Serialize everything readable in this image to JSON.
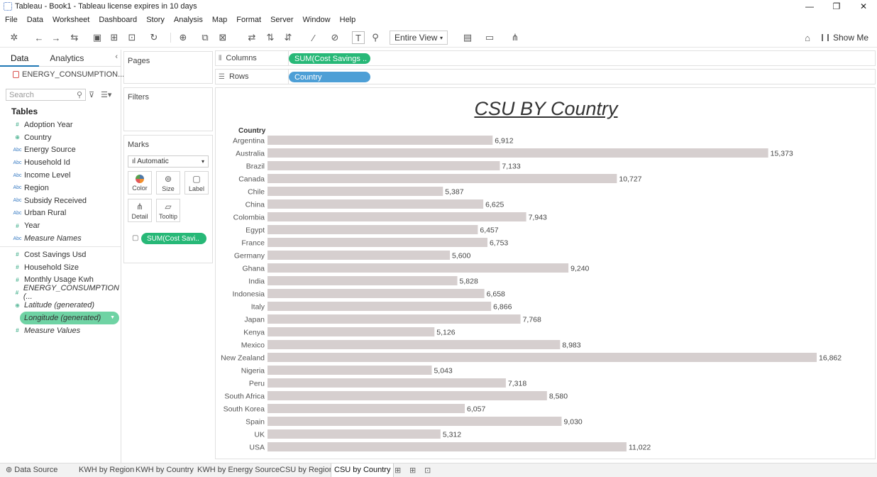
{
  "window": {
    "title": "Tableau - Book1 - Tableau license expires in 10 days",
    "controls": [
      "—",
      "❐",
      "✕"
    ]
  },
  "menu": [
    "File",
    "Data",
    "Worksheet",
    "Dashboard",
    "Story",
    "Analysis",
    "Map",
    "Format",
    "Server",
    "Window",
    "Help"
  ],
  "toolbar": {
    "view_select": "Entire View",
    "show_me": "Show Me"
  },
  "data_pane": {
    "tabs": [
      "Data",
      "Analytics"
    ],
    "datasource": "ENERGY_CONSUMPTION...",
    "search_placeholder": "Search",
    "tables_label": "Tables",
    "dimensions": [
      {
        "name": "Adoption Year",
        "type": "#"
      },
      {
        "name": "Country",
        "type": "⊕"
      },
      {
        "name": "Energy Source",
        "type": "Abc"
      },
      {
        "name": "Household Id",
        "type": "Abc"
      },
      {
        "name": "Income Level",
        "type": "Abc"
      },
      {
        "name": "Region",
        "type": "Abc"
      },
      {
        "name": "Subsidy Received",
        "type": "Abc"
      },
      {
        "name": "Urban Rural",
        "type": "Abc"
      },
      {
        "name": "Year",
        "type": "#"
      },
      {
        "name": "Measure Names",
        "type": "Abc"
      }
    ],
    "measures": [
      {
        "name": "Cost Savings Usd",
        "type": "#"
      },
      {
        "name": "Household Size",
        "type": "#"
      },
      {
        "name": "Monthly Usage Kwh",
        "type": "#"
      },
      {
        "name": "ENERGY_CONSUMPTION (...",
        "type": "#"
      },
      {
        "name": "Latitude (generated)",
        "type": "⊕"
      },
      {
        "name": "Longitude (generated)",
        "type": "⊕"
      },
      {
        "name": "Measure Values",
        "type": "#"
      }
    ]
  },
  "cards": {
    "pages": "Pages",
    "filters": "Filters",
    "marks": "Marks",
    "mark_type": "Automatic",
    "mark_buttons": [
      "Color",
      "Size",
      "Label",
      "Detail",
      "Tooltip"
    ],
    "mark_pill": "SUM(Cost Savi.."
  },
  "shelves": {
    "columns_label": "Columns",
    "columns_pill": "SUM(Cost Savings ..",
    "rows_label": "Rows",
    "rows_pill": "Country"
  },
  "chart_data": {
    "type": "bar",
    "orientation": "horizontal",
    "title": "CSU BY Country",
    "row_header": "Country",
    "categories": [
      "Argentina",
      "Australia",
      "Brazil",
      "Canada",
      "Chile",
      "China",
      "Colombia",
      "Egypt",
      "France",
      "Germany",
      "Ghana",
      "India",
      "Indonesia",
      "Italy",
      "Japan",
      "Kenya",
      "Mexico",
      "New Zealand",
      "Nigeria",
      "Peru",
      "South Africa",
      "South Korea",
      "Spain",
      "UK",
      "USA"
    ],
    "values": [
      6912,
      15373,
      7133,
      10727,
      5387,
      6625,
      7943,
      6457,
      6753,
      5600,
      9240,
      5828,
      6658,
      6866,
      7768,
      5126,
      8983,
      16862,
      5043,
      7318,
      8580,
      6057,
      9030,
      5312,
      11022
    ],
    "value_labels": [
      "6,912",
      "15,373",
      "7,133",
      "10,727",
      "5,387",
      "6,625",
      "7,943",
      "6,457",
      "6,753",
      "5,600",
      "9,240",
      "5,828",
      "6,658",
      "6,866",
      "7,768",
      "5,126",
      "8,983",
      "16,862",
      "5,043",
      "7,318",
      "8,580",
      "6,057",
      "9,030",
      "5,312",
      "11,022"
    ],
    "bar_color": "#d6cfcf",
    "xlim": [
      0,
      16862
    ]
  },
  "sheets": {
    "data_source": "Data Source",
    "tabs": [
      "KWH by Region",
      "KWH by Country",
      "KWH by Energy Source",
      "CSU by Region",
      "CSU by Country"
    ],
    "active": "CSU by Country"
  }
}
